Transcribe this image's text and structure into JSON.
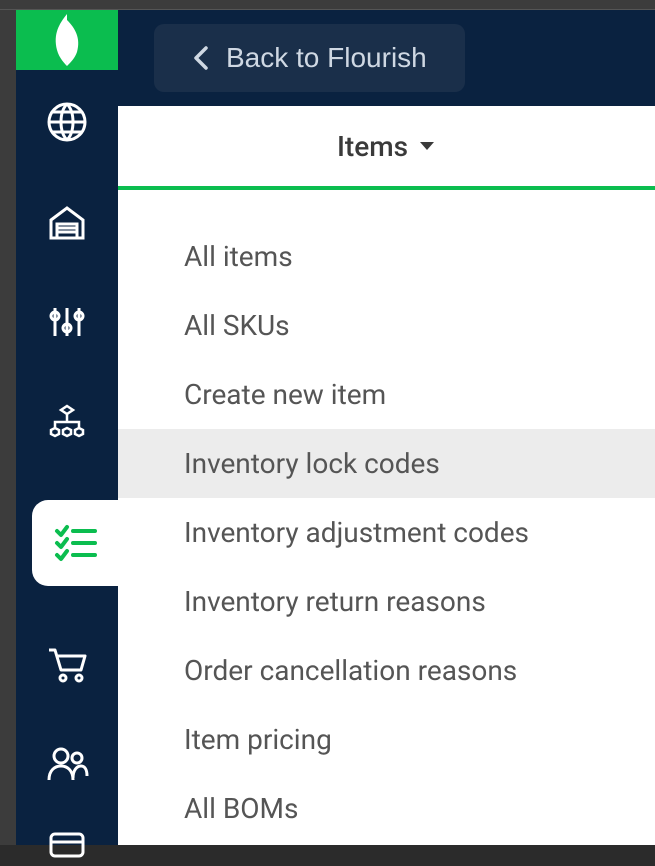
{
  "header": {
    "back_label": "Back to Flourish"
  },
  "tab": {
    "label": "Items"
  },
  "sidebar": {
    "items": [
      {
        "name": "globe"
      },
      {
        "name": "warehouse"
      },
      {
        "name": "sliders"
      },
      {
        "name": "hierarchy"
      },
      {
        "name": "checklist",
        "active": true
      },
      {
        "name": "cart"
      },
      {
        "name": "users"
      },
      {
        "name": "card"
      }
    ]
  },
  "dropdown": {
    "items": [
      {
        "label": "All items"
      },
      {
        "label": "All SKUs"
      },
      {
        "label": "Create new item"
      },
      {
        "label": "Inventory lock codes",
        "highlighted": true
      },
      {
        "label": "Inventory adjustment codes"
      },
      {
        "label": "Inventory return reasons"
      },
      {
        "label": "Order cancellation reasons"
      },
      {
        "label": "Item pricing"
      },
      {
        "label": "All BOMs"
      }
    ]
  }
}
